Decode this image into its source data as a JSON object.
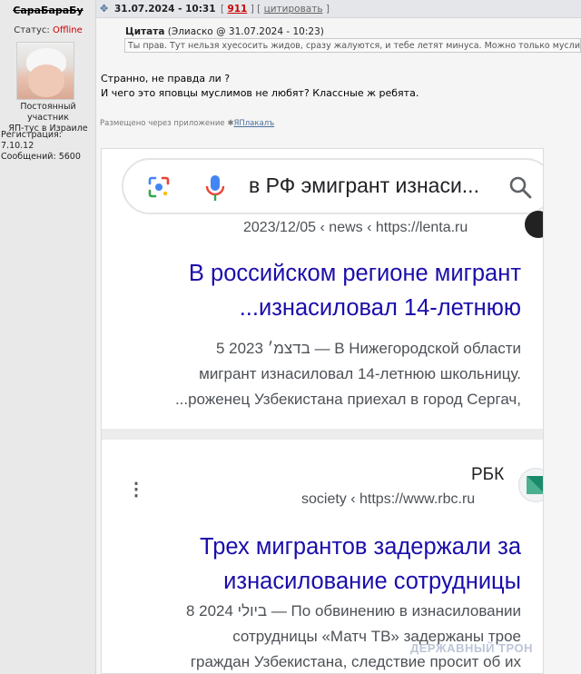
{
  "user": {
    "name": "СараБараБу",
    "status_label": "Статус:",
    "status_value": "Offline",
    "rank_line1": "Постоянный участник",
    "rank_line2": "ЯП-тус в Израиле",
    "registered": "Регистрация: 7.10.12",
    "messages": "Сообщений: 5600"
  },
  "post": {
    "icon": "pin-icon",
    "date": "31.07.2024 - 10:31",
    "number": "911",
    "cite_label": "цитировать",
    "quote_label": "Цитата",
    "quote_author": "(Элиаско @ 31.07.2024 - 10:23)",
    "quote_text": "Ты прав. Тут нельзя хуесосить жидов, сразу жалуются, и тебе летят минуса. Можно только муслимов смешивать",
    "line1": "Странно, не правда ли ?",
    "line2": "И чего это яповцы муслимов не любят? Классные ж ребята.",
    "via_text": "Размещено через приложение",
    "via_app": "ЯПлакалъ"
  },
  "screenshot": {
    "query": "в РФ эмигрант изнаси...",
    "result1": {
      "url": "2023/12/05 ‹ news ‹ https://lenta.ru",
      "title_l1": "В российском регионе мигрант",
      "title_l2": "...изнасиловал 14-летнюю",
      "snip_l1": "5 בדצמ׳ 2023 — В Нижегородской области",
      "snip_l2": "мигрант изнасиловал 14-летнюю школьницу.",
      "snip_l3": "...роженец Узбекистана приехал в город Сергач,"
    },
    "result2": {
      "site": "РБК",
      "url": "society ‹ https://www.rbc.ru",
      "title_l1": "Трех мигрантов задержали за",
      "title_l2": "изнасилование сотрудницы",
      "snip_l1": "8 ביולי 2024 — По обвинению в изнасиловании",
      "snip_l2": "сотрудницы «Матч ТВ» задержаны трое",
      "snip_l3": "граждан Узбекистана, следствие просит об их"
    },
    "watermark": "ДЕРЖАВНЫЙ ТРОН"
  }
}
